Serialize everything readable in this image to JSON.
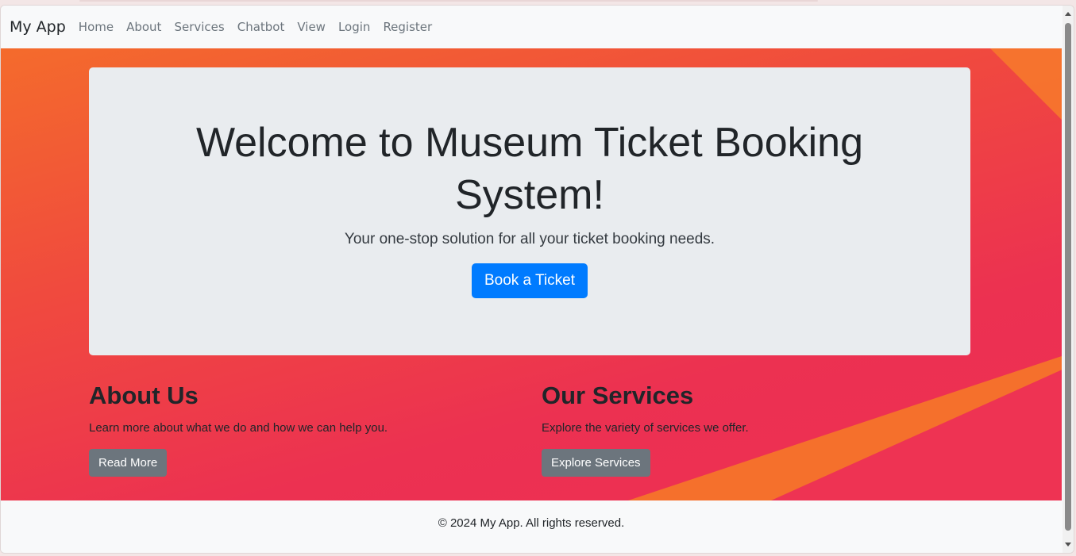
{
  "navbar": {
    "brand": "My App",
    "links": [
      "Home",
      "About",
      "Services",
      "Chatbot",
      "View",
      "Login",
      "Register"
    ]
  },
  "jumbotron": {
    "title": "Welcome to Museum Ticket Booking System!",
    "subtitle": "Your one-stop solution for all your ticket booking needs.",
    "button": "Book a Ticket"
  },
  "about": {
    "heading": "About Us",
    "text": "Learn more about what we do and how we can help you.",
    "button": "Read More"
  },
  "services": {
    "heading": "Our Services",
    "text": "Explore the variety of services we offer.",
    "button": "Explore Services"
  },
  "footer": {
    "text": "© 2024 My App. All rights reserved."
  },
  "colors": {
    "primary": "#007bff",
    "secondary": "#6c757d",
    "hero_gradient_start": "#f46b2c",
    "hero_gradient_end": "#ee2e54"
  }
}
